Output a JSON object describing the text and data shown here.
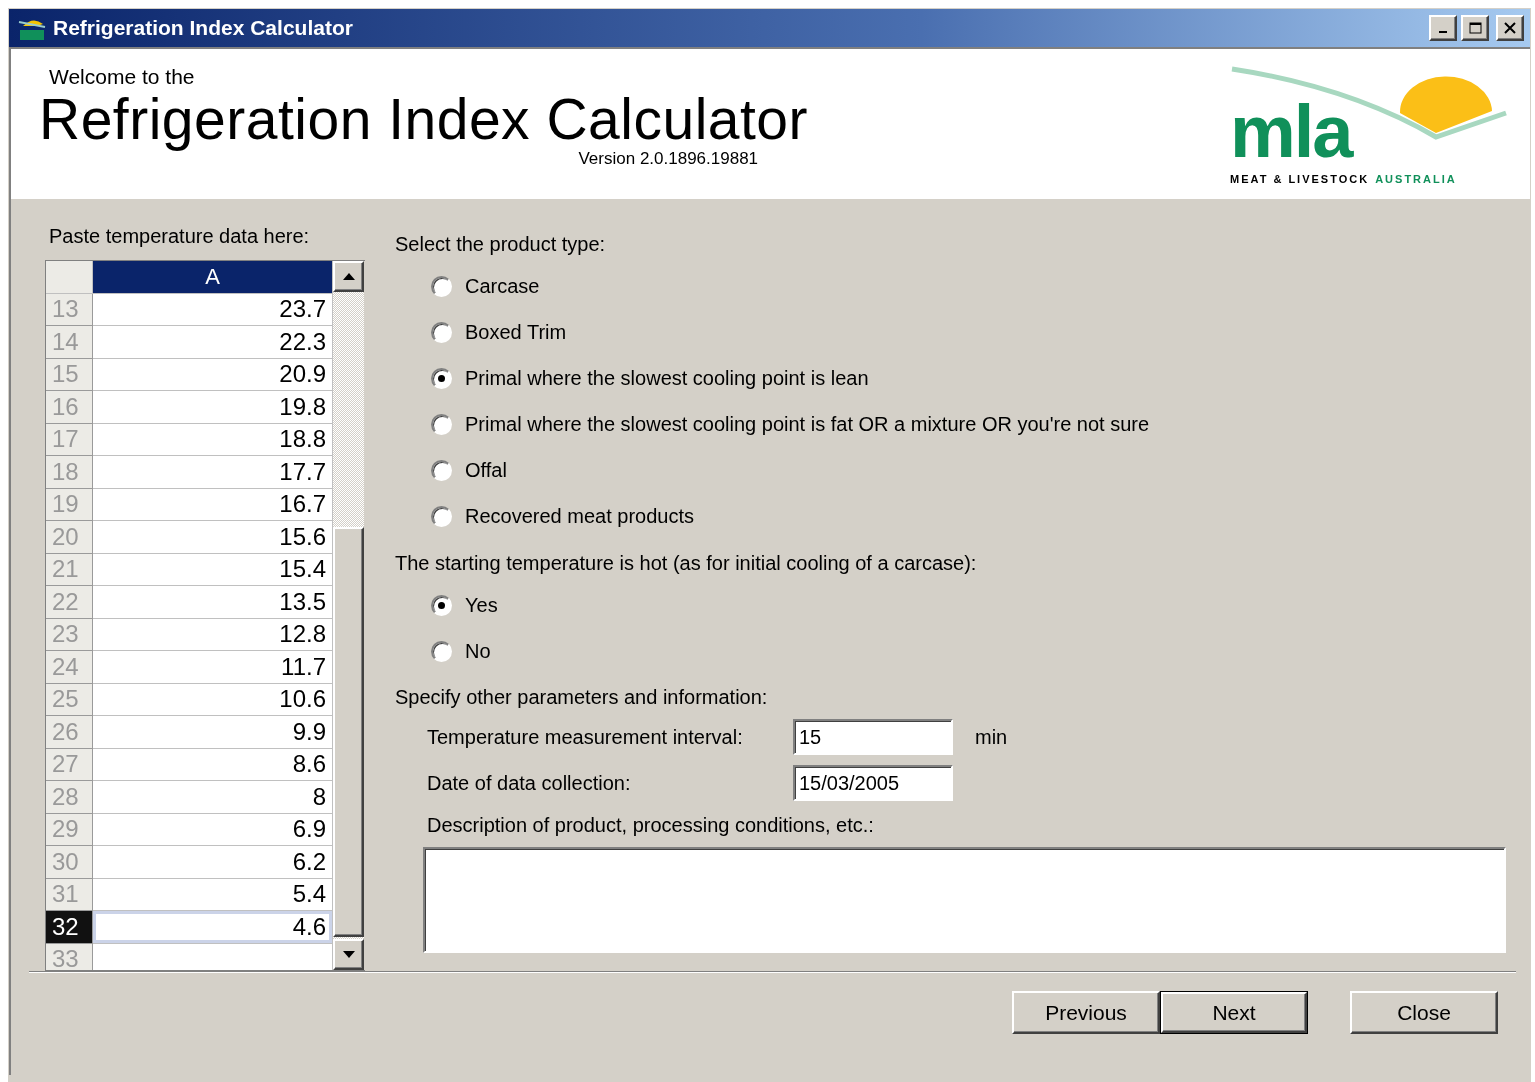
{
  "window": {
    "title": "Refrigeration Index Calculator"
  },
  "header": {
    "welcome": "Welcome to the",
    "title": "Refrigeration Index Calculator",
    "version": "Version 2.0.1896.19881",
    "logo": {
      "wordmark": "mla",
      "tagline": "MEAT & LIVESTOCK",
      "country": "AUSTRALIA"
    }
  },
  "grid": {
    "label": "Paste temperature data here:",
    "column": "A",
    "rows": [
      {
        "number": "13",
        "value": "23.7",
        "selected": false
      },
      {
        "number": "14",
        "value": "22.3",
        "selected": false
      },
      {
        "number": "15",
        "value": "20.9",
        "selected": false
      },
      {
        "number": "16",
        "value": "19.8",
        "selected": false
      },
      {
        "number": "17",
        "value": "18.8",
        "selected": false
      },
      {
        "number": "18",
        "value": "17.7",
        "selected": false
      },
      {
        "number": "19",
        "value": "16.7",
        "selected": false
      },
      {
        "number": "20",
        "value": "15.6",
        "selected": false
      },
      {
        "number": "21",
        "value": "15.4",
        "selected": false
      },
      {
        "number": "22",
        "value": "13.5",
        "selected": false
      },
      {
        "number": "23",
        "value": "12.8",
        "selected": false
      },
      {
        "number": "24",
        "value": "11.7",
        "selected": false
      },
      {
        "number": "25",
        "value": "10.6",
        "selected": false
      },
      {
        "number": "26",
        "value": "9.9",
        "selected": false
      },
      {
        "number": "27",
        "value": "8.6",
        "selected": false
      },
      {
        "number": "28",
        "value": "8",
        "selected": false
      },
      {
        "number": "29",
        "value": "6.9",
        "selected": false
      },
      {
        "number": "30",
        "value": "6.2",
        "selected": false
      },
      {
        "number": "31",
        "value": "5.4",
        "selected": false
      },
      {
        "number": "32",
        "value": "4.6",
        "selected": true
      },
      {
        "number": "33",
        "selected": false
      }
    ]
  },
  "product_type": {
    "label": "Select the product type:",
    "options": [
      {
        "label": "Carcase",
        "selected": false
      },
      {
        "label": "Boxed Trim",
        "selected": false
      },
      {
        "label": "Primal where the slowest cooling point is lean",
        "selected": true
      },
      {
        "label": "Primal where the slowest cooling point is fat OR a mixture OR you're not sure",
        "selected": false
      },
      {
        "label": "Offal",
        "selected": false
      },
      {
        "label": "Recovered meat products",
        "selected": false
      }
    ]
  },
  "hot_start": {
    "label": "The starting temperature is hot (as for initial cooling of a carcase):",
    "options": [
      {
        "label": "Yes",
        "selected": true
      },
      {
        "label": "No",
        "selected": false
      }
    ]
  },
  "parameters": {
    "label": "Specify other parameters and information:",
    "interval": {
      "label": "Temperature measurement interval:",
      "value": "15",
      "unit": "min"
    },
    "date": {
      "label": "Date of data collection:",
      "value": "15/03/2005"
    },
    "description": {
      "label": "Description of product, processing conditions, etc.:"
    }
  },
  "buttons": [
    {
      "label": "Previous",
      "default": false
    },
    {
      "label": "Next",
      "default": true
    },
    {
      "label": "Close",
      "default": false
    }
  ]
}
